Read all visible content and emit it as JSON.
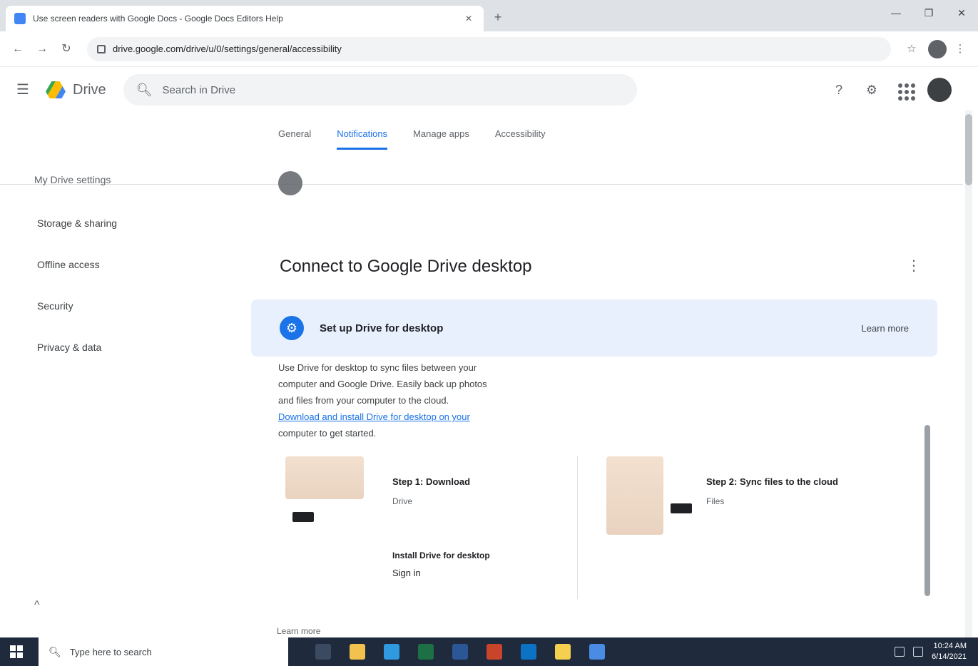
{
  "browser": {
    "tab_title": "Use screen readers with Google Docs - Google Docs Editors Help",
    "tab_close": "✕",
    "new_tab": "+",
    "window_controls": [
      "—",
      "❐",
      "✕"
    ],
    "url": "drive.google.com/drive/u/0/settings/general/accessibility",
    "nav": [
      "←",
      "→",
      "↻"
    ],
    "toolbar_icons": [
      "☆",
      "⋮"
    ]
  },
  "app": {
    "menu_icon": "☰",
    "name": "Drive",
    "search_placeholder": "Search in Drive",
    "right_icons": [
      "?",
      "⚙"
    ]
  },
  "settings_tabs": [
    {
      "label": "General",
      "active": false
    },
    {
      "label": "Notifications",
      "active": true
    },
    {
      "label": "Manage apps",
      "active": false
    },
    {
      "label": "Accessibility",
      "active": false
    }
  ],
  "sidebar": {
    "heading": "My Drive settings",
    "items": [
      "Storage & sharing",
      "Offline access",
      "Security",
      "Privacy & data"
    ],
    "footer": "^"
  },
  "card": {
    "title": "Connect to Google Drive desktop",
    "more": "⋮",
    "banner_title": "Set up Drive for desktop",
    "banner_link": "Learn more",
    "desc_lines": [
      "Use Drive for desktop to sync files between your",
      "computer and Google Drive. Easily back up photos",
      "and files from your computer to the cloud.",
      "Download and install Drive for desktop on your",
      "computer to get started."
    ],
    "left_pane_title": "Step 1: Download",
    "left_pane_sub": "Drive",
    "left_pane_small": "Install Drive for desktop",
    "left_pane_small2": "Sign in",
    "right_pane_title": "Step 2: Sync files to the cloud",
    "right_pane_sub": "Files"
  },
  "bottom_hint": "Learn more",
  "taskbar": {
    "search_placeholder": "Type here to search",
    "apps": [
      {
        "name": "task-view-icon",
        "color": "#3b4a60"
      },
      {
        "name": "file-explorer-icon",
        "color": "#f2c14e"
      },
      {
        "name": "edge-icon",
        "color": "#2f9ae0"
      },
      {
        "name": "excel-icon",
        "color": "#1d7044"
      },
      {
        "name": "word-icon",
        "color": "#2b5797"
      },
      {
        "name": "powerpoint-icon",
        "color": "#c8452c"
      },
      {
        "name": "outlook-icon",
        "color": "#0b72c5"
      },
      {
        "name": "sticky-notes-icon",
        "color": "#f5d04e"
      },
      {
        "name": "chrome-icon",
        "color": "#4a8be3"
      }
    ],
    "time": "10:24 AM",
    "date": "6/14/2021"
  }
}
